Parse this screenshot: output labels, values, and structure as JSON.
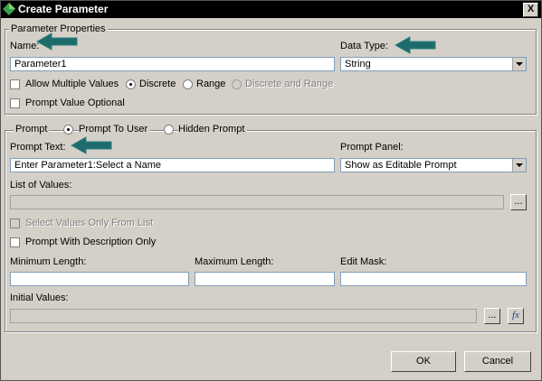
{
  "window": {
    "title": "Create Parameter",
    "close_label": "X"
  },
  "parameter_properties": {
    "legend": "Parameter Properties",
    "name_label": "Name:",
    "name_value": "Parameter1",
    "data_type_label": "Data Type:",
    "data_type_value": "String",
    "allow_multiple_label": "Allow Multiple Values",
    "discrete_label": "Discrete",
    "range_label": "Range",
    "discrete_and_range_label": "Discrete and Range",
    "value_optional_label": "Prompt Value Optional"
  },
  "prompt": {
    "legend": "Prompt",
    "prompt_to_user_label": "Prompt To User",
    "hidden_prompt_label": "Hidden Prompt",
    "prompt_text_label": "Prompt Text:",
    "prompt_text_value": "Enter Parameter1:Select a Name",
    "prompt_panel_label": "Prompt Panel:",
    "prompt_panel_value": "Show as Editable Prompt",
    "list_of_values_label": "List of Values:",
    "browse_label": "...",
    "select_only_from_list_label": "Select Values Only From List",
    "with_description_label": "Prompt With Description Only",
    "min_length_label": "Minimum Length:",
    "max_length_label": "Maximum Length:",
    "edit_mask_label": "Edit Mask:",
    "initial_values_label": "Initial Values:",
    "initial_browse_label": "...",
    "fx_label": "fx"
  },
  "footer": {
    "ok_label": "OK",
    "cancel_label": "Cancel"
  },
  "colors": {
    "arrow": "#1f6b6b"
  }
}
